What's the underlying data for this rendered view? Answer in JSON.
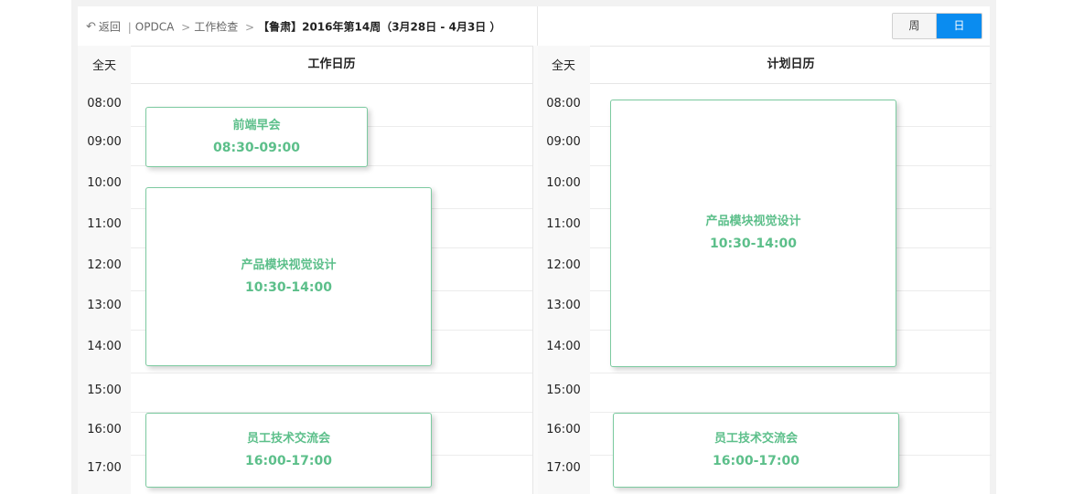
{
  "breadcrumb": {
    "back": "返回",
    "sep1": "|",
    "module": "OPDCA",
    "arrow1": ">",
    "section": "工作检查",
    "arrow2": ">",
    "current": "【鲁肃】2016年第14周（3月28日 - 4月3日 ）"
  },
  "view_toggle": {
    "week": "周",
    "day": "日",
    "active": "日"
  },
  "colors": {
    "accent": "#0a8cf0",
    "event_text": "#5cbf8a",
    "event_border": "#7ccaa0"
  },
  "work_calendar": {
    "title": "工作日历",
    "allday_label": "全天",
    "hours": [
      "08:00",
      "09:00",
      "10:00",
      "11:00",
      "12:00",
      "13:00",
      "14:00",
      "15:00",
      "16:00",
      "17:00"
    ],
    "events": [
      {
        "title": "前端早会",
        "time": "08:30-09:00"
      },
      {
        "title": "产品模块视觉设计",
        "time": "10:30-14:00"
      },
      {
        "title": "员工技术交流会",
        "time": "16:00-17:00"
      }
    ]
  },
  "plan_calendar": {
    "title": "计划日历",
    "allday_label": "全天",
    "hours": [
      "08:00",
      "09:00",
      "10:00",
      "11:00",
      "12:00",
      "13:00",
      "14:00",
      "15:00",
      "16:00",
      "17:00"
    ],
    "events": [
      {
        "title": "产品模块视觉设计",
        "time": "10:30-14:00"
      },
      {
        "title": "员工技术交流会",
        "time": "16:00-17:00"
      }
    ]
  }
}
